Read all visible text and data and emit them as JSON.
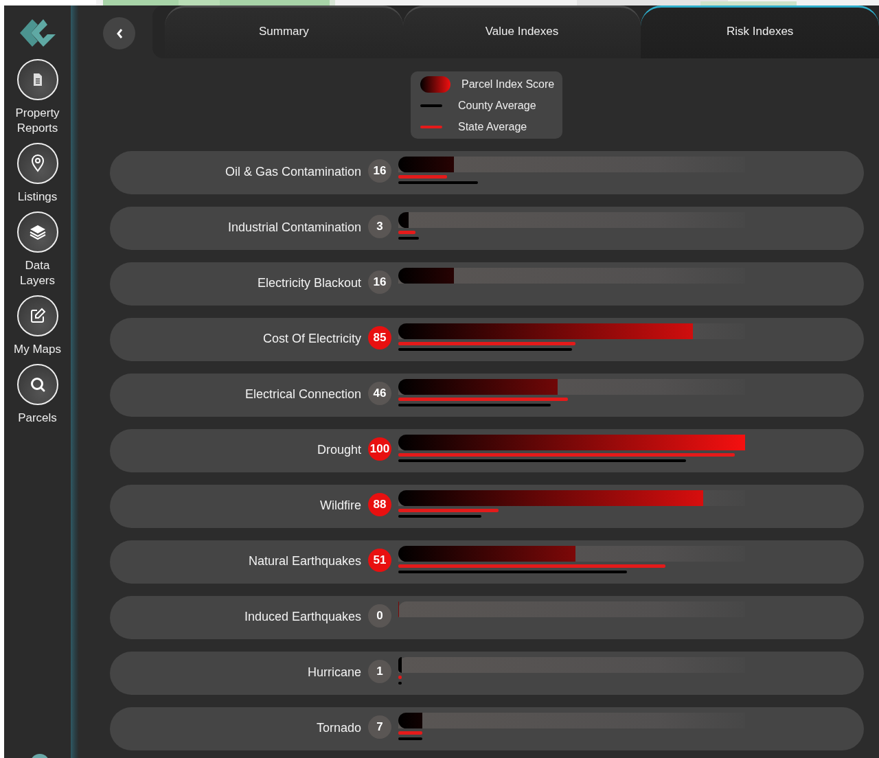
{
  "sidebar": {
    "items": [
      {
        "label": "Property Reports"
      },
      {
        "label": "Listings"
      },
      {
        "label": "Data Layers"
      },
      {
        "label": "My Maps"
      },
      {
        "label": "Parcels"
      }
    ]
  },
  "tabs": [
    {
      "label": "Summary",
      "selected": false
    },
    {
      "label": "Value Indexes",
      "selected": false
    },
    {
      "label": "Risk Indexes",
      "selected": true
    }
  ],
  "legend": [
    {
      "kind": "score",
      "label": "Parcel Index Score"
    },
    {
      "kind": "county",
      "label": "County Average"
    },
    {
      "kind": "state",
      "label": "State Average"
    }
  ],
  "rows": [
    {
      "label": "Oil & Gas Contamination",
      "score": "16",
      "highlighted": false,
      "level": 0.16,
      "state_average": {
        "level": 0.14
      },
      "county_average": {
        "level": 0.23
      }
    },
    {
      "label": "Industrial Contamination",
      "score": "3",
      "highlighted": false,
      "level": 0.03,
      "state_average": {
        "level": 0.05
      },
      "county_average": {
        "level": 0.06
      }
    },
    {
      "label": "Electricity Blackout",
      "score": "16",
      "highlighted": false,
      "level": 0.16
    },
    {
      "label": "Cost Of Electricity",
      "score": "85",
      "highlighted": true,
      "level": 0.85,
      "state_average": {
        "level": 0.51
      },
      "county_average": {
        "level": 0.5
      }
    },
    {
      "label": "Electrical Connection",
      "score": "46",
      "highlighted": false,
      "level": 0.46,
      "state_average": {
        "level": 0.49
      },
      "county_average": {
        "level": 0.44
      }
    },
    {
      "label": "Drought",
      "score": "100",
      "highlighted": true,
      "level": 1,
      "state_average": {
        "level": 0.97
      },
      "county_average": {
        "level": 0.83
      }
    },
    {
      "label": "Wildfire",
      "score": "88",
      "highlighted": true,
      "level": 0.88,
      "state_average": {
        "level": 0.29
      },
      "county_average": {
        "level": 0.24
      }
    },
    {
      "label": "Natural Earthquakes",
      "score": "51",
      "highlighted": true,
      "level": 0.51,
      "state_average": {
        "level": 0.77
      },
      "county_average": {
        "level": 0.66
      }
    },
    {
      "label": "Induced Earthquakes",
      "score": "0",
      "highlighted": false,
      "level": 0
    },
    {
      "label": "Hurricane",
      "score": "1",
      "highlighted": false,
      "level": 0.01,
      "state_average": {
        "level": 0.01
      },
      "county_average": {
        "level": 0.01
      }
    },
    {
      "label": "Tornado",
      "score": "7",
      "highlighted": false,
      "level": 0.07,
      "state_average": {
        "level": 0.07
      },
      "county_average": {
        "level": 0.07
      }
    }
  ]
}
